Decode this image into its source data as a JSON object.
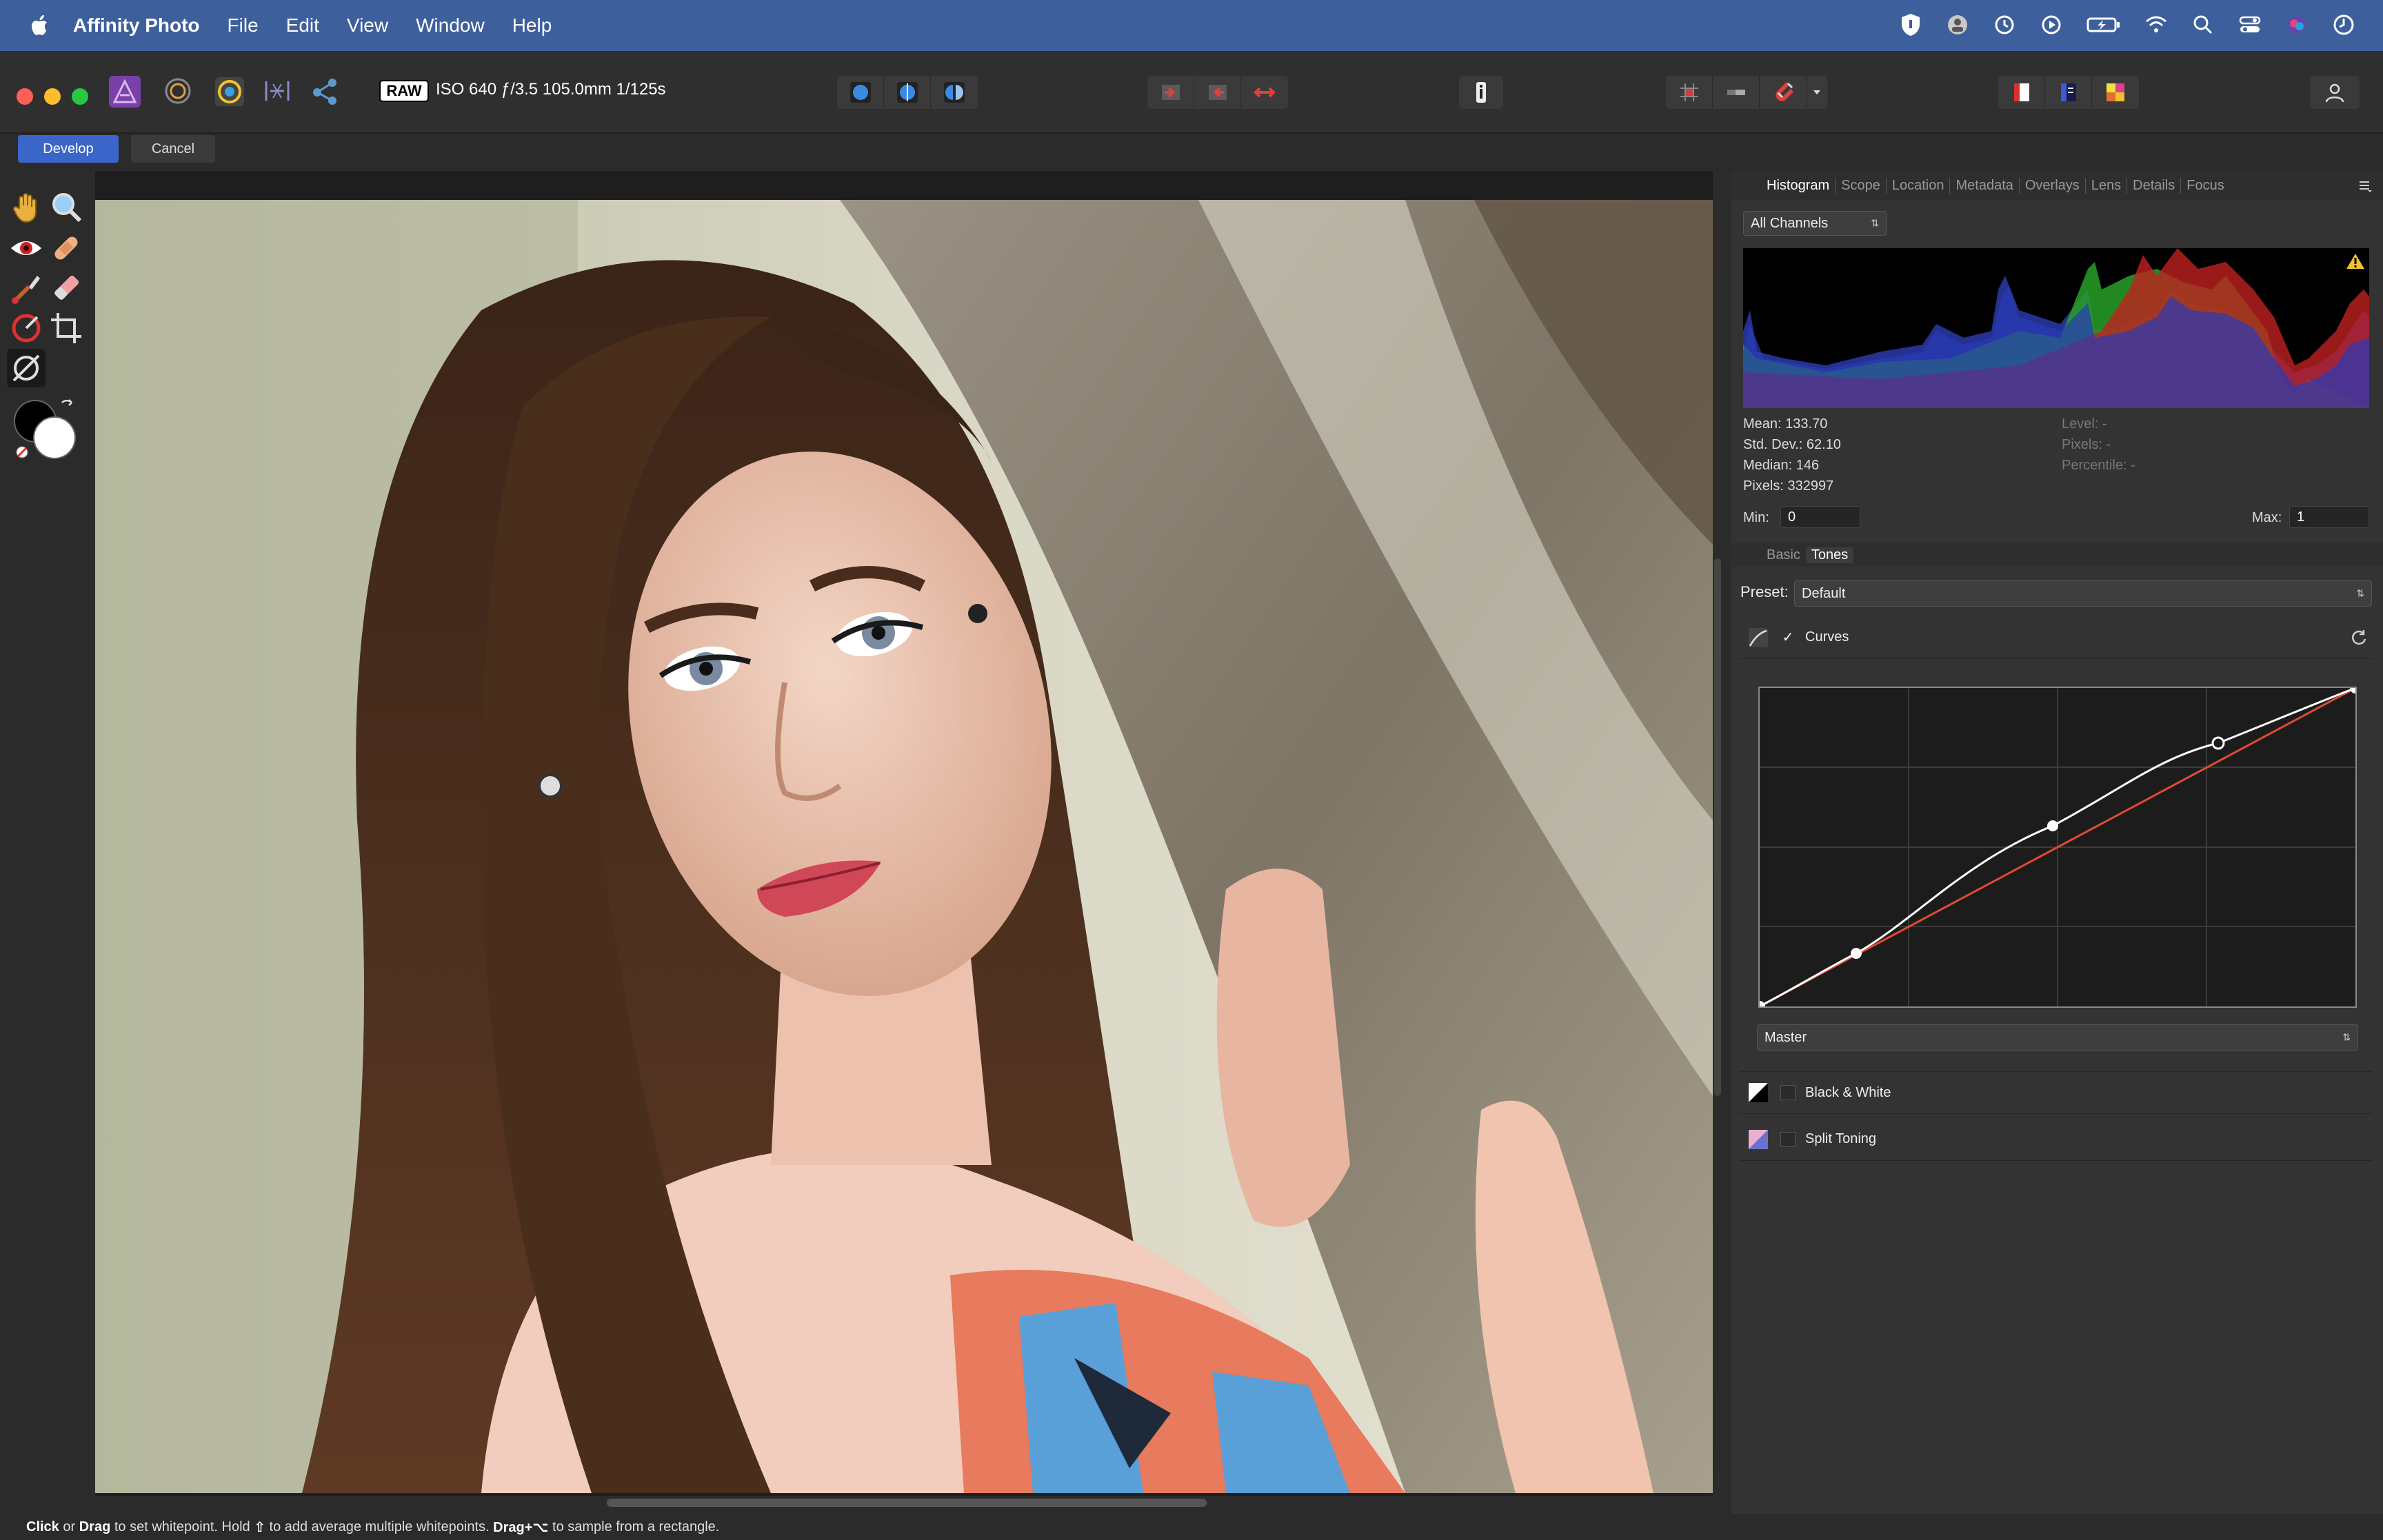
{
  "menubar": {
    "app_name": "Affinity Photo",
    "menus": [
      "File",
      "Edit",
      "View",
      "Window",
      "Help"
    ]
  },
  "toolbar": {
    "raw_badge": "RAW",
    "exif": "ISO 640 ƒ/3.5 105.0mm 1/125s"
  },
  "develop_bar": {
    "develop_label": "Develop",
    "cancel_label": "Cancel"
  },
  "panel": {
    "tabs": [
      "Histogram",
      "Scope",
      "Location",
      "Metadata",
      "Overlays",
      "Lens",
      "Details",
      "Focus"
    ],
    "channel_select": "All Channels",
    "stats": {
      "mean": "Mean: 133.70",
      "std_dev": "Std. Dev.: 62.10",
      "median": "Median: 146",
      "pixels": "Pixels: 332997",
      "level": "Level: -",
      "pixels_right": "Pixels: -",
      "percentile": "Percentile: -"
    },
    "min_label": "Min:",
    "min_value": "0",
    "max_label": "Max:",
    "max_value": "1",
    "subtabs": [
      "Basic",
      "Tones"
    ],
    "preset_label": "Preset:",
    "preset_value": "Default",
    "curves_label": "Curves",
    "curves_check": "✓",
    "curve_channel": "Master",
    "black_white_label": "Black & White",
    "split_toning_label": "Split Toning"
  },
  "statusbar": {
    "click": "Click",
    "or": " or ",
    "drag": "Drag",
    "text1": " to set whitepoint. Hold ",
    "shift_glyph": "⇧",
    "text2": " to add average multiple whitepoints. ",
    "drag_alt": "Drag+⌥",
    "text3": " to sample from a rectangle."
  },
  "colors": {
    "accent": "#3a66c9",
    "menubar": "#3d5f9c",
    "panel_bg": "#333333",
    "curve_line": "#ffffff",
    "curve_reference": "#e04a35"
  },
  "icons": {
    "menubar_status": [
      "vpn-shield-icon",
      "user-badge-icon",
      "time-machine-icon",
      "play-icon",
      "battery-charging-icon",
      "wifi-icon",
      "spotlight-search-icon",
      "control-center-icon",
      "siri-icon",
      "clock-icon"
    ]
  }
}
